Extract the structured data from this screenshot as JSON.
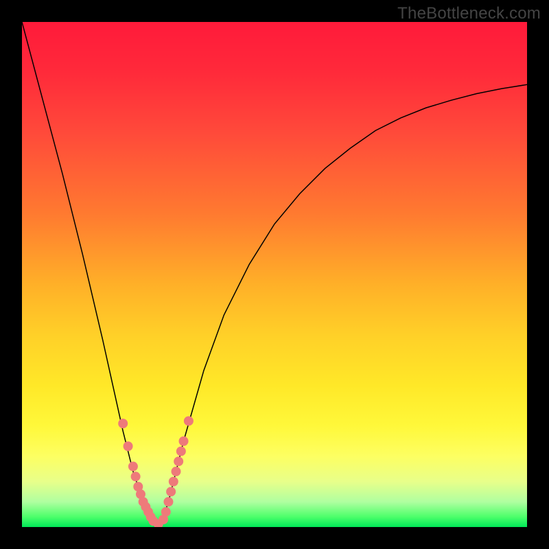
{
  "watermark": "TheBottleneck.com",
  "colors": {
    "dot": "#ee7a7a",
    "curve": "#000000",
    "frame": "#000000"
  },
  "chart_data": {
    "type": "line",
    "title": "",
    "xlabel": "",
    "ylabel": "",
    "xlim": [
      0,
      100
    ],
    "ylim": [
      0,
      100
    ],
    "grid": false,
    "legend": false,
    "series": [
      {
        "name": "curve-left",
        "x": [
          0,
          4,
          8,
          12,
          16,
          18,
          20,
          21,
          22,
          23,
          24,
          25,
          26,
          27
        ],
        "y": [
          100,
          85,
          70,
          54,
          37,
          28,
          19,
          15,
          11,
          8,
          5,
          3,
          1.5,
          0.5
        ]
      },
      {
        "name": "curve-right",
        "x": [
          27,
          28,
          29,
          30,
          31,
          32,
          34,
          36,
          40,
          45,
          50,
          55,
          60,
          65,
          70,
          75,
          80,
          85,
          90,
          95,
          100
        ],
        "y": [
          0.5,
          2,
          5,
          9,
          13,
          17,
          24,
          31,
          42,
          52,
          60,
          66,
          71,
          75,
          78.5,
          81,
          83,
          84.5,
          85.8,
          86.8,
          87.6
        ]
      }
    ],
    "dots": {
      "name": "highlighted-points",
      "x": [
        20,
        21,
        22,
        22.5,
        23,
        23.5,
        24,
        24.5,
        25,
        25.5,
        26,
        27,
        28,
        28.5,
        29,
        29.5,
        30,
        30.5,
        31,
        31.5,
        32,
        33
      ],
      "y": [
        20.5,
        16,
        12,
        10,
        8,
        6.5,
        5,
        4,
        3,
        2,
        1.2,
        0.6,
        1.5,
        3,
        5,
        7,
        9,
        11,
        13,
        15,
        17,
        21
      ]
    },
    "minimum_x": 27
  }
}
